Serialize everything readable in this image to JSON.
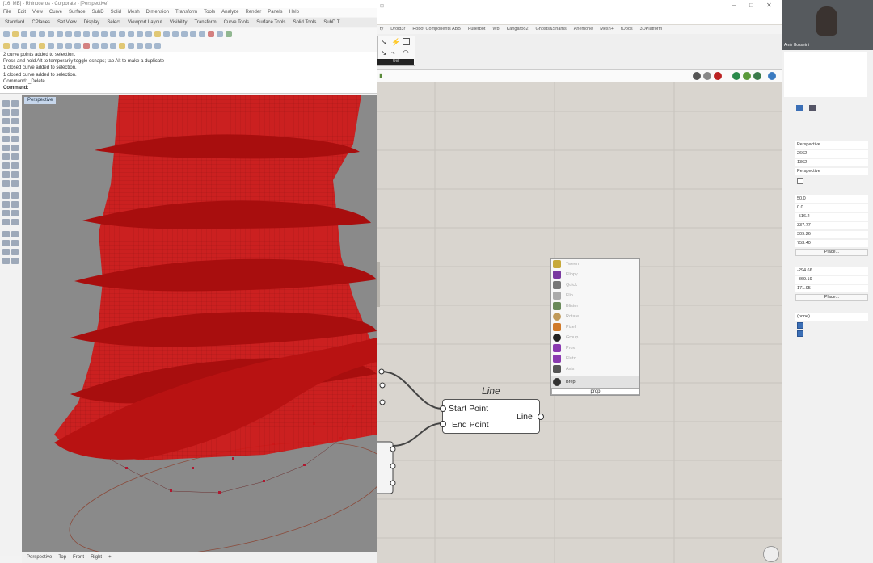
{
  "rhino": {
    "title": "[16_MB] - Rhinoceros - Corporate - [Perspective]",
    "menu": [
      "File",
      "Edit",
      "View",
      "Curve",
      "Surface",
      "SubD",
      "Solid",
      "Mesh",
      "Dimension",
      "Transform",
      "Tools",
      "Analyze",
      "Render",
      "Panels",
      "Help"
    ],
    "toolbar_tabs": [
      "Standard",
      "CPlanes",
      "Set View",
      "Display",
      "Select",
      "Viewport Layout",
      "Visibility",
      "Transform",
      "Curve Tools",
      "Surface Tools",
      "Solid Tools",
      "SubD T"
    ],
    "command_history": [
      "2 curve points added to selection.",
      "Press and hold Alt to temporarily toggle osnaps; tap Alt to make a duplicate",
      "1 closed curve added to selection.",
      "1 closed curve added to selection.",
      "Command: _Delete"
    ],
    "command_prompt": "Command:",
    "viewport_label": "Perspective",
    "viewport_tabs": [
      "Perspective",
      "Top",
      "Front",
      "Right",
      "+"
    ]
  },
  "grasshopper": {
    "tabs": [
      "ty",
      "Droid3r",
      "Robot Components ABB",
      "Fullerbot",
      "Wb",
      "Kangaroo2",
      "Ghosts&Shams",
      "Anemone",
      "Mesh+",
      "tOpos",
      "3DPlatform"
    ],
    "ribbon_group_label": "Util",
    "line_component": {
      "nickname": "Line",
      "input_start": "Start Point",
      "input_end": "End Point",
      "output": "Line"
    },
    "search_results": [
      "Tween",
      "Flippy",
      "Quick",
      "Flip",
      "Blister",
      "Rotate",
      "Pixel",
      "Group",
      "Prox",
      "Flatz",
      "Axis",
      "Brep"
    ],
    "search_query": "prop"
  },
  "right_panel": {
    "webcam_name": "Amir Hosseini",
    "fields_a": [
      "Perspective",
      "2662",
      "1362",
      "Perspective"
    ],
    "fields_b": [
      "50.0",
      "0.0",
      "-516.2",
      "337.77",
      "309.26",
      "753.40"
    ],
    "place_label_1": "Place...",
    "fields_c": [
      "-294.66",
      "-369.19",
      "171.95"
    ],
    "place_label_2": "Place...",
    "dropdown": "(none)"
  },
  "colors": {
    "surface_red": "#d01818",
    "viewport_bg": "#8a8a8a",
    "gh_canvas": "#d9d5cf"
  }
}
